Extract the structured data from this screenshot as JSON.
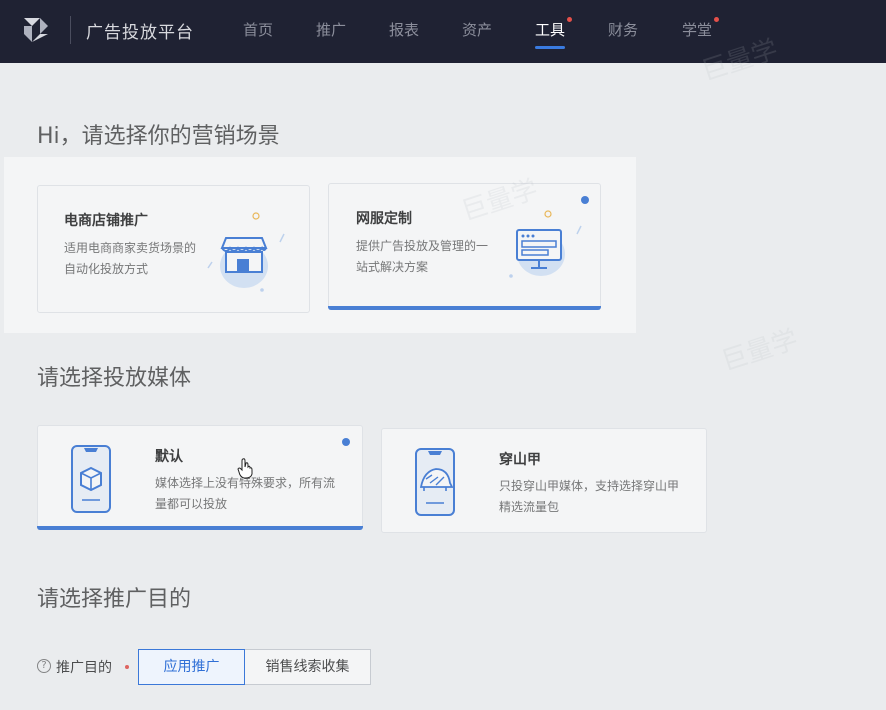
{
  "header": {
    "brand": "广告投放平台",
    "nav": [
      {
        "label": "首页",
        "active": false,
        "dot": false
      },
      {
        "label": "推广",
        "active": false,
        "dot": false
      },
      {
        "label": "报表",
        "active": false,
        "dot": false
      },
      {
        "label": "资产",
        "active": false,
        "dot": false
      },
      {
        "label": "工具",
        "active": true,
        "dot": true
      },
      {
        "label": "财务",
        "active": false,
        "dot": false
      },
      {
        "label": "学堂",
        "active": false,
        "dot": true
      }
    ]
  },
  "scene_section": {
    "title": "Hi，请选择你的营销场景",
    "cards": [
      {
        "title": "电商店铺推广",
        "desc": "适用电商商家卖货场景的自动化投放方式",
        "selected": false,
        "icon": "storefront-icon"
      },
      {
        "title": "网服定制",
        "desc": "提供广告投放及管理的一站式解决方案",
        "selected": true,
        "icon": "monitor-icon"
      }
    ]
  },
  "media_section": {
    "title": "请选择投放媒体",
    "cards": [
      {
        "title": "默认",
        "desc": "媒体选择上没有特殊要求，所有流量都可以投放",
        "selected": true,
        "icon": "phone-box-icon"
      },
      {
        "title": "穿山甲",
        "desc": "只投穿山甲媒体，支持选择穿山甲精选流量包",
        "selected": false,
        "icon": "phone-pangolin-icon"
      }
    ]
  },
  "goal_section": {
    "title": "请选择推广目的",
    "label": "推广目的",
    "options": [
      {
        "label": "应用推广",
        "active": true
      },
      {
        "label": "销售线索收集",
        "active": false
      }
    ]
  },
  "watermark": "巨量学",
  "colors": {
    "accent": "#2f6fd6",
    "nav_bg": "#1f2233",
    "badge": "#e4504a"
  }
}
